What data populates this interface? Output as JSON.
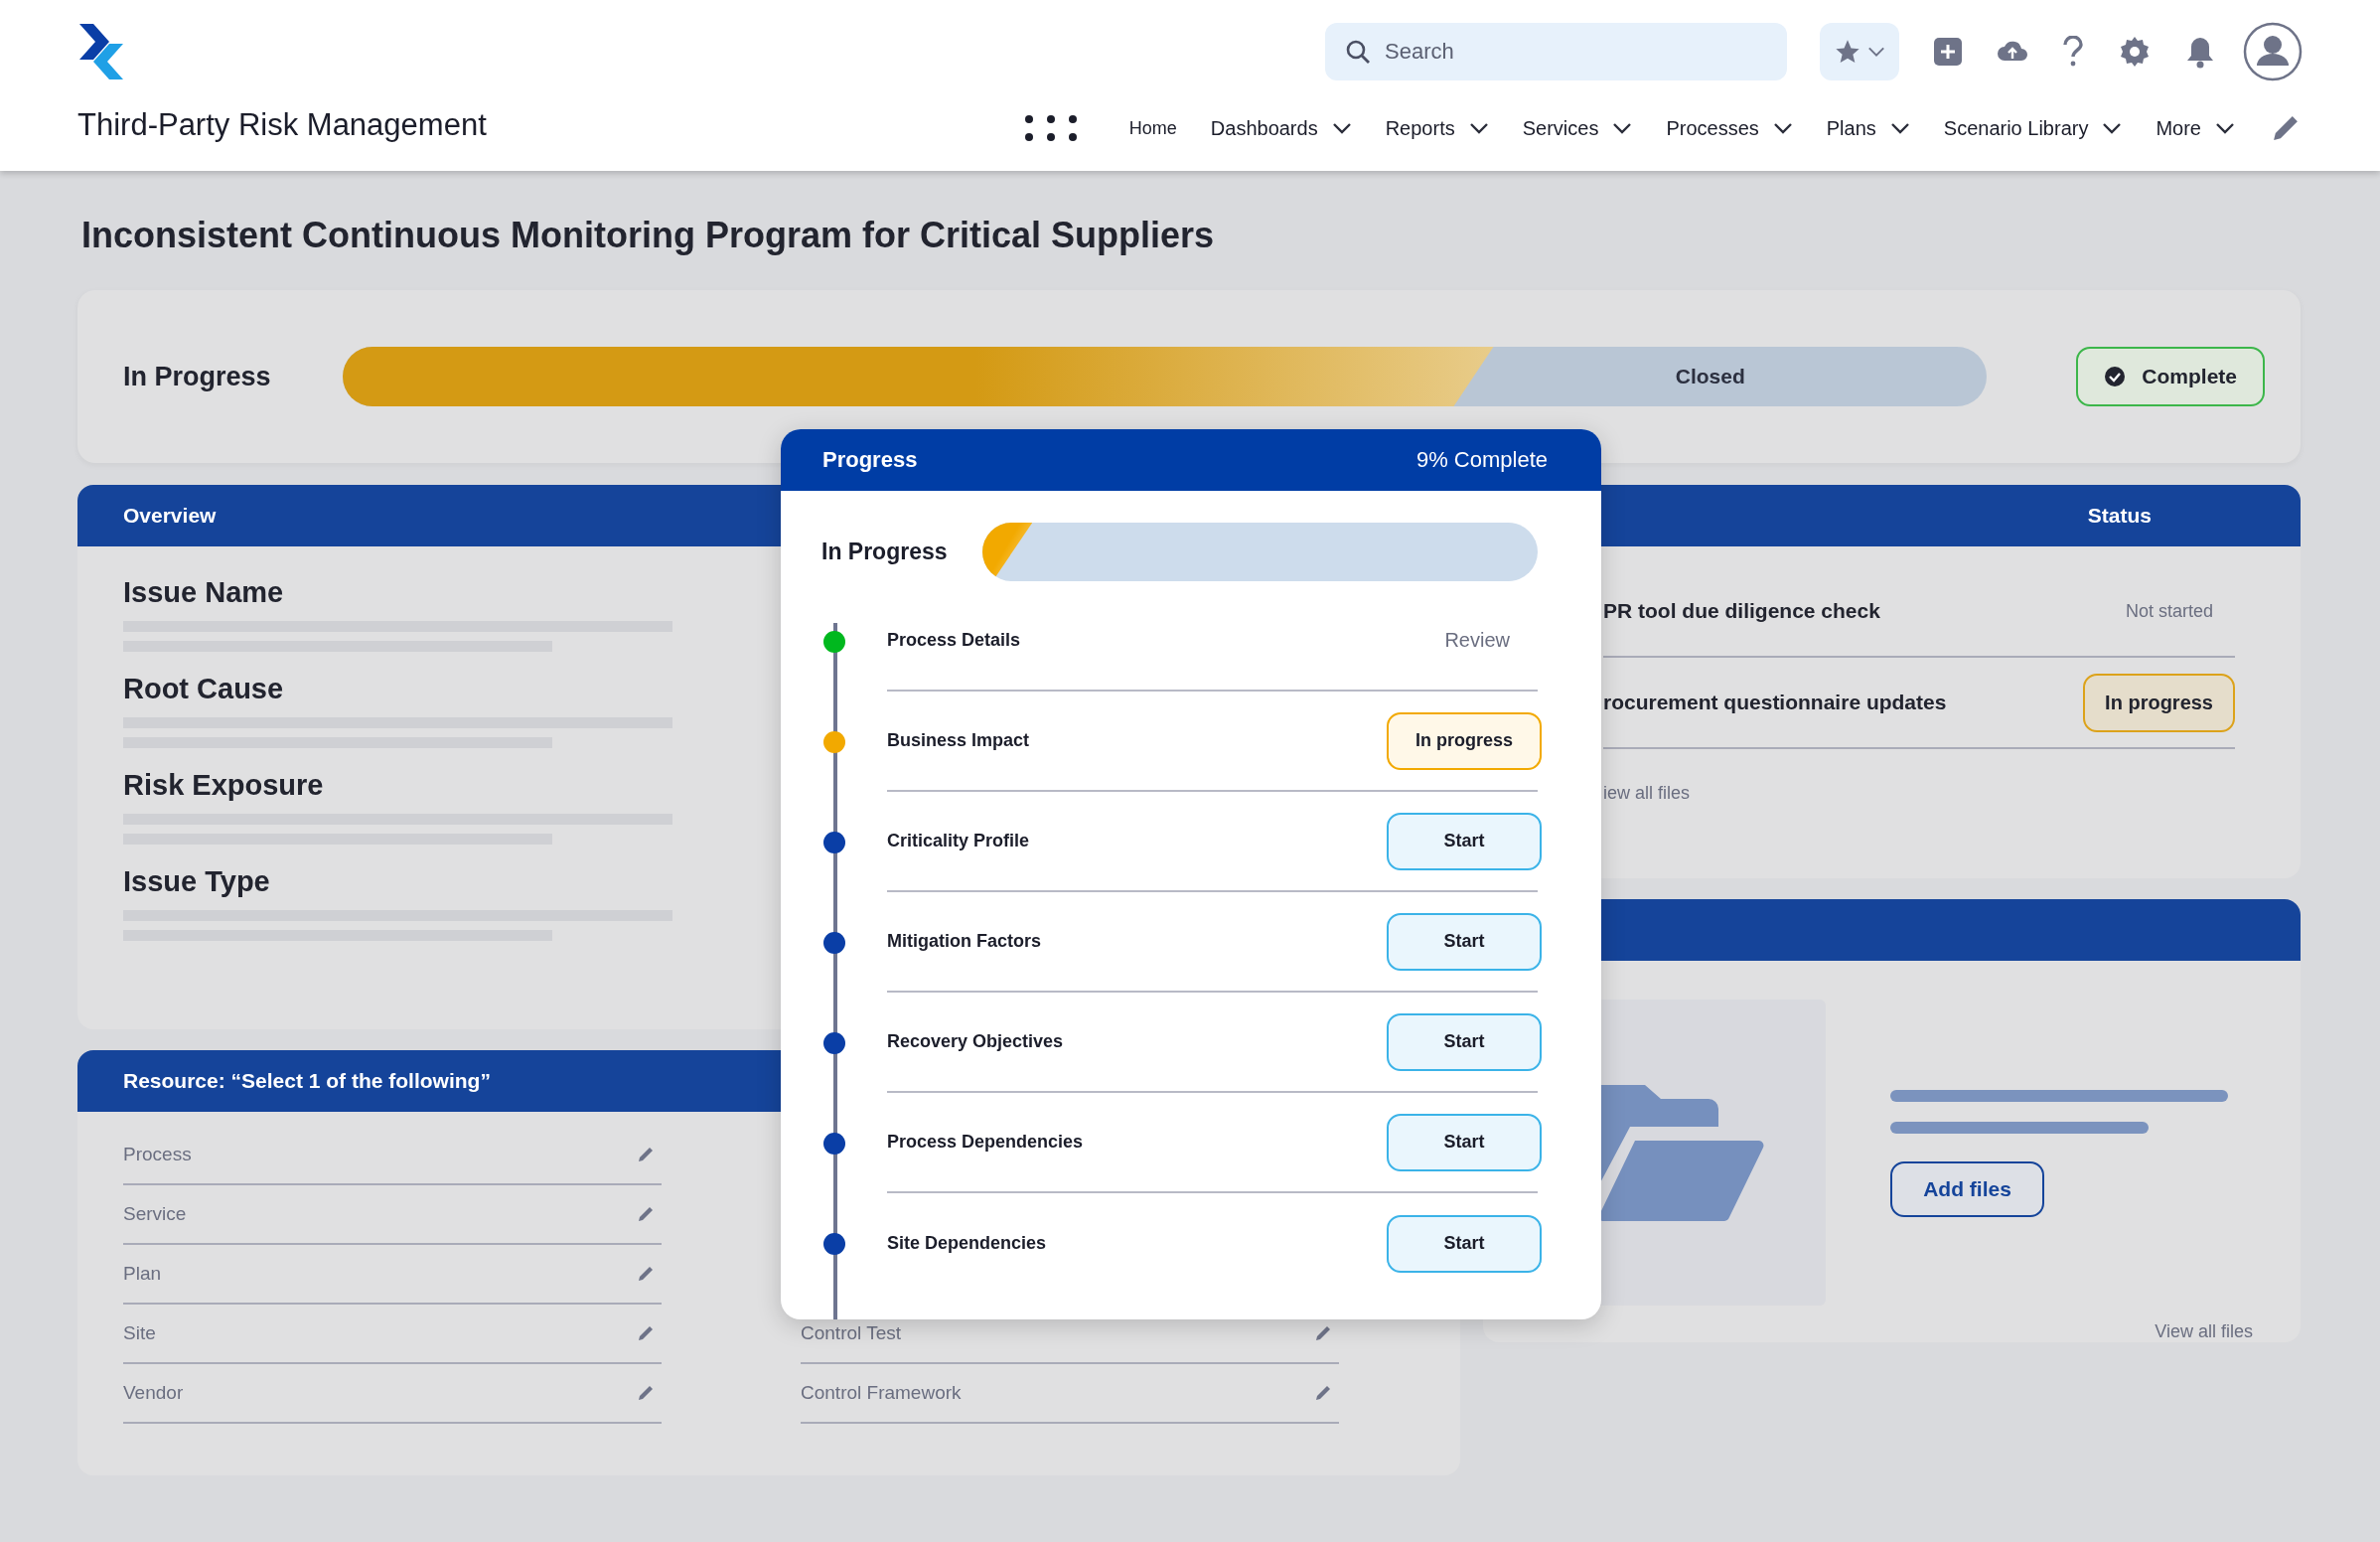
{
  "app": {
    "title": "Third-Party Risk Management"
  },
  "search": {
    "placeholder": "Search"
  },
  "nav": [
    {
      "label": "Home",
      "dropdown": false
    },
    {
      "label": "Dashboards",
      "dropdown": true
    },
    {
      "label": "Reports",
      "dropdown": true
    },
    {
      "label": "Services",
      "dropdown": true
    },
    {
      "label": "Processes",
      "dropdown": true
    },
    {
      "label": "Plans",
      "dropdown": true
    },
    {
      "label": "Scenario Library",
      "dropdown": true
    },
    {
      "label": "More",
      "dropdown": true
    }
  ],
  "page_title": "Inconsistent Continuous Monitoring Program for Critical Suppliers",
  "status": {
    "label": "In Progress",
    "level": 0.7,
    "remaining_label": "Closed",
    "complete_button": "Complete"
  },
  "overview": {
    "title": "Overview",
    "fields": [
      "Issue Name",
      "Root Cause",
      "Risk Exposure",
      "Issue Type"
    ]
  },
  "tasks": {
    "status_heading": "Status",
    "rows": [
      {
        "name": "PR tool due diligence check",
        "status": "Not started",
        "kind": "text"
      },
      {
        "name": "rocurement questionnaire updates",
        "status": "In progress",
        "kind": "badge"
      }
    ],
    "link": "iew all files"
  },
  "files": {
    "add_button": "Add files",
    "link": "View all files"
  },
  "resource": {
    "title": "Resource: “Select 1 of the following”",
    "left": [
      "Process",
      "Service",
      "Plan",
      "Site",
      "Vendor"
    ],
    "right": [
      "Control Test",
      "Control Framework"
    ]
  },
  "progress": {
    "title": "Progress",
    "summary": "9% Complete",
    "label": "In Progress",
    "level": 0.09,
    "steps": [
      {
        "name": "Process Details",
        "color": "#00b81e",
        "kind": "link",
        "action": "Review"
      },
      {
        "name": "Business Impact",
        "color": "#f2a900",
        "kind": "badge",
        "action": "In progress"
      },
      {
        "name": "Criticality Profile",
        "color": "#0a3ea6",
        "kind": "button",
        "action": "Start"
      },
      {
        "name": "Mitigation Factors",
        "color": "#0a3ea6",
        "kind": "button",
        "action": "Start"
      },
      {
        "name": "Recovery Objectives",
        "color": "#0a3ea6",
        "kind": "button",
        "action": "Start"
      },
      {
        "name": "Process Dependencies",
        "color": "#0a3ea6",
        "kind": "button",
        "action": "Start"
      },
      {
        "name": "Site Dependencies",
        "color": "#0a3ea6",
        "kind": "button",
        "action": "Start"
      }
    ]
  }
}
